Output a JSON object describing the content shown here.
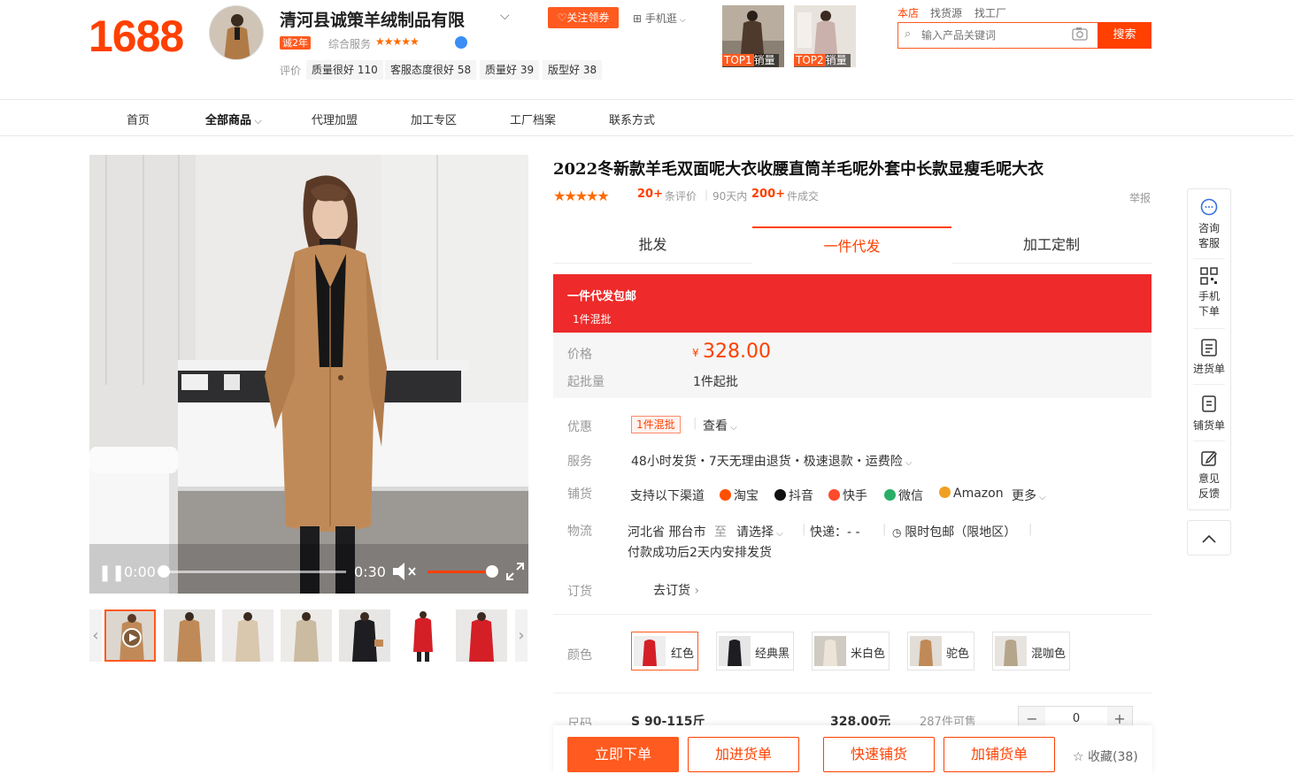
{
  "header": {
    "logo": "1688",
    "shop_name": "清河县诚策羊绒制品有限",
    "shop_years": "诚2年",
    "service_label": "综合服务",
    "service_stars": "★★★★★",
    "review_label": "评价",
    "tags": [
      "质量很好 110",
      "客服态度很好 58",
      "质量好 39",
      "版型好 38"
    ],
    "follow_label": "♡关注领券",
    "mobile_label": "手机逛",
    "top_products": [
      {
        "rank": "TOP1",
        "label": "销量"
      },
      {
        "rank": "TOP2",
        "label": "销量"
      }
    ],
    "search_scopes": [
      "本店",
      "找货源",
      "找工厂"
    ],
    "search_placeholder": "输入产品关键词",
    "search_button": "搜索"
  },
  "nav": {
    "items": [
      "首页",
      "全部商品",
      "代理加盟",
      "加工专区",
      "工厂档案",
      "联系方式"
    ]
  },
  "gallery": {
    "time_current": "0:00",
    "time_total": "0:30"
  },
  "product": {
    "title": "2022冬新款羊毛双面呢大衣收腰直筒羊毛呢外套中长款显瘦毛呢大衣",
    "rating_stars": "★★★★★",
    "review_count": "20+",
    "review_suffix": "条评价",
    "period_label": "90天内",
    "sold_count": "200+",
    "sold_suffix": "件成交",
    "report_label": "举报",
    "tabs": [
      "批发",
      "一件代发",
      "加工定制"
    ],
    "banner_title": "一件代发包邮",
    "banner_sub": "1件混批",
    "price_label": "价格",
    "currency": "¥",
    "price": "328.00",
    "moq_label": "起批量",
    "moq_value": "1件起批",
    "discount_label": "优惠",
    "discount_badge": "1件混批",
    "discount_view": "查看",
    "service_label": "服务",
    "service_value": "48小时发货・7天无理由退货・极速退款・运费险",
    "distribution_label": "铺货",
    "distribution_intro": "支持以下渠道",
    "platforms": [
      "淘宝",
      "抖音",
      "快手",
      "微信",
      "Amazon"
    ],
    "more_label": "更多",
    "logistics_label": "物流",
    "origin": "河北省 邢台市",
    "to_label": "至",
    "destination": "请选择",
    "express": "快递：- -",
    "free_shipping": "限时包邮（限地区）",
    "ship_note": "付款成功后2天内安排发货",
    "order_label": "订货",
    "order_link": "去订货",
    "color_label": "颜色",
    "colors": [
      "红色",
      "经典黑",
      "米白色",
      "驼色",
      "混咖色"
    ],
    "size_label": "尺码",
    "size_name": "S 90-115斤",
    "size_price": "328.00元",
    "size_stock": "287件可售",
    "size_qty": "0"
  },
  "actions": {
    "buy_now": "立即下单",
    "add_cart": "加进货单",
    "quick_dist": "快速铺货",
    "add_dist": "加铺货单",
    "favorite": "收藏(38)"
  },
  "sidebar": {
    "items": [
      {
        "l1": "咨询",
        "l2": "客服"
      },
      {
        "l1": "手机",
        "l2": "下单"
      },
      {
        "l1": "进货单",
        "l2": ""
      },
      {
        "l1": "铺货单",
        "l2": ""
      },
      {
        "l1": "意见",
        "l2": "反馈"
      }
    ]
  }
}
